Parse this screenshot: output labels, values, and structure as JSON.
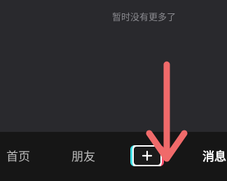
{
  "feed": {
    "end_message": "暂时没有更多了"
  },
  "tab_bar": {
    "home_label": "首页",
    "friends_label": "朋友",
    "create_icon": "plus-icon",
    "messages_label": "消息"
  },
  "annotation": {
    "arrow_color": "#f06a6a",
    "pointing_to": "create-button"
  },
  "colors": {
    "background": "#29292d",
    "tab_bar": "#161616",
    "accent_cyan": "#3ee0e6",
    "accent_red": "#ff4d6d"
  }
}
